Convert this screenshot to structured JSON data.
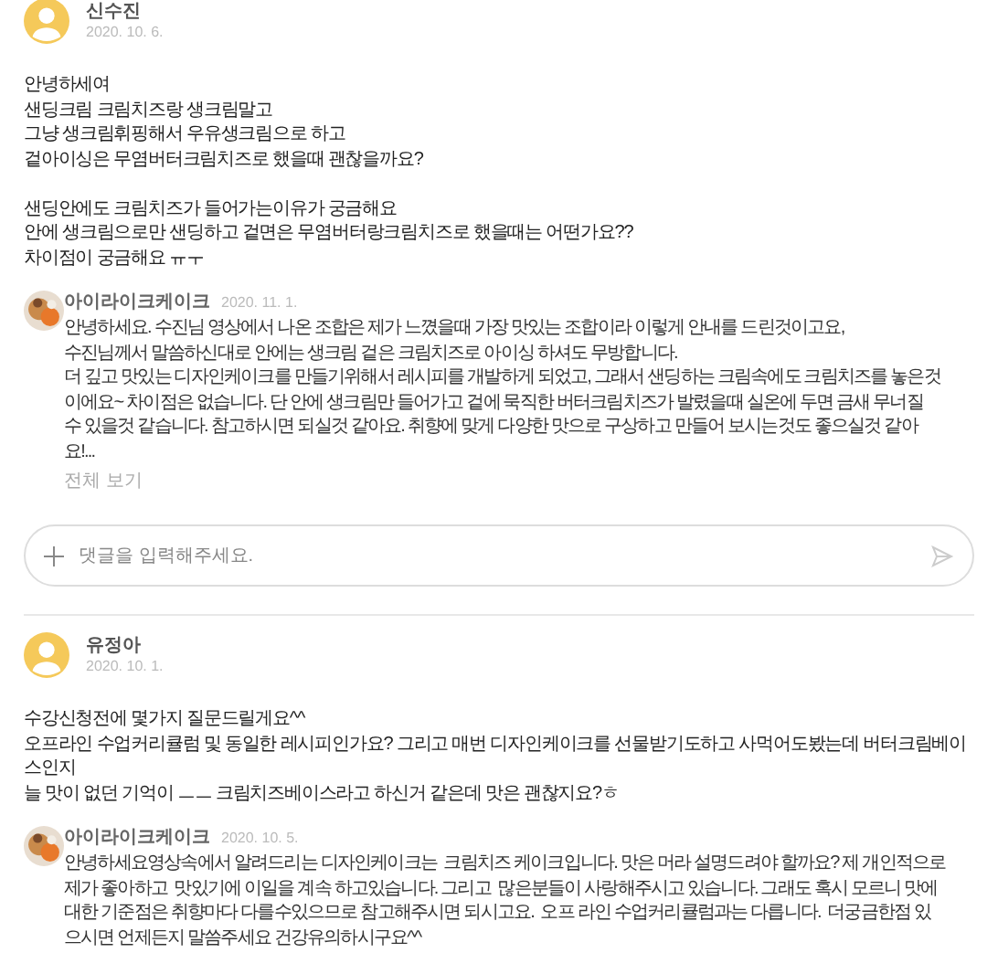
{
  "comments": [
    {
      "author": "신수진",
      "date": "2020. 10. 6.",
      "paragraphs": [
        [
          "안녕하세여",
          "샌딩크림 크림치즈랑 생크림말고",
          "그냥 생크림휘핑해서 우유생크림으로 하고",
          "겉아이싱은 무염버터크림치즈로 했을때 괜찮을까요?"
        ],
        [
          "샌딩안에도 크림치즈가 들어가는이유가 궁금해요",
          "안에 생크림으로만 샌딩하고 겉면은 무염버터랑크림치즈로 했을때는 어떤가요??",
          "차이점이 궁금해요 ㅠㅜ"
        ]
      ],
      "reply": {
        "author": "아이라이크케이크",
        "date": "2020. 11. 1.",
        "lines": [
          "안녕하세요. 수진님 영상에서 나온 조합은 제가 느꼈을때 가장 맛있는 조합이라 이렇게 안내를 드린것이고요,",
          "수진님께서 말씀하신대로 안에는 생크림 겉은 크림치즈로 아이싱 하셔도 무방합니다.",
          "더 깊고 맛있는 디자인케이크를 만들기위해서 레시피를 개발하게 되었고, 그래서 샌딩하는 크림속에도 크림치즈를 놓은것",
          "이에요~ 차이점은 없습니다. 단 안에 생크림만 들어가고 겉에 묵직한 버터크림치즈가 발렸을때 실온에 두면 금새 무너질",
          "수 있을것 같습니다. 참고하시면 되실것 같아요. 취향에 맞게 다양한 맛으로 구상하고 만들어 보시는것도 좋으실것 같아",
          "요!..."
        ],
        "more": "전체 보기"
      }
    },
    {
      "author": "유정아",
      "date": "2020. 10. 1.",
      "paragraphs": [
        [
          "수강신청전에 몇가지 질문드릴게요^^",
          "오프라인 수업커리큘럼 및 동일한 레시피인가요? 그리고 매번 디자인케이크를 선물받기도하고 사먹어도봤는데 버터크림베이",
          "스인지",
          "늘 맛이 없던 기억이 ㅡㅡ 크림치즈베이스라고 하신거 같은데 맛은 괜찮지요?ㅎ"
        ]
      ],
      "reply": {
        "author": "아이라이크케이크",
        "date": "2020. 10. 5.",
        "lines": [
          "안녕하세요영상속에서 알려드리는 디자인케이크는  크림치즈 케이크입니다. 맛은 머라 설명드려야 할까요? 제 개인적으로",
          "제가 좋아하고  맛있기에 이일을 계속 하고있습니다. 그리고  많은분들이 사랑해주시고 있습니다. 그래도 혹시 모르니 맛에",
          "대한 기준점은 취향마다 다를수있으므로 참고해주시면 되시고요.  오프 라인 수업커리큘럼과는 다릅니다.  더궁금한점 있",
          "으시면 언제든지 말씀주세요 건강유의하시구요^^"
        ]
      }
    }
  ],
  "comment_input": {
    "placeholder": "댓글을 입력해주세요."
  }
}
